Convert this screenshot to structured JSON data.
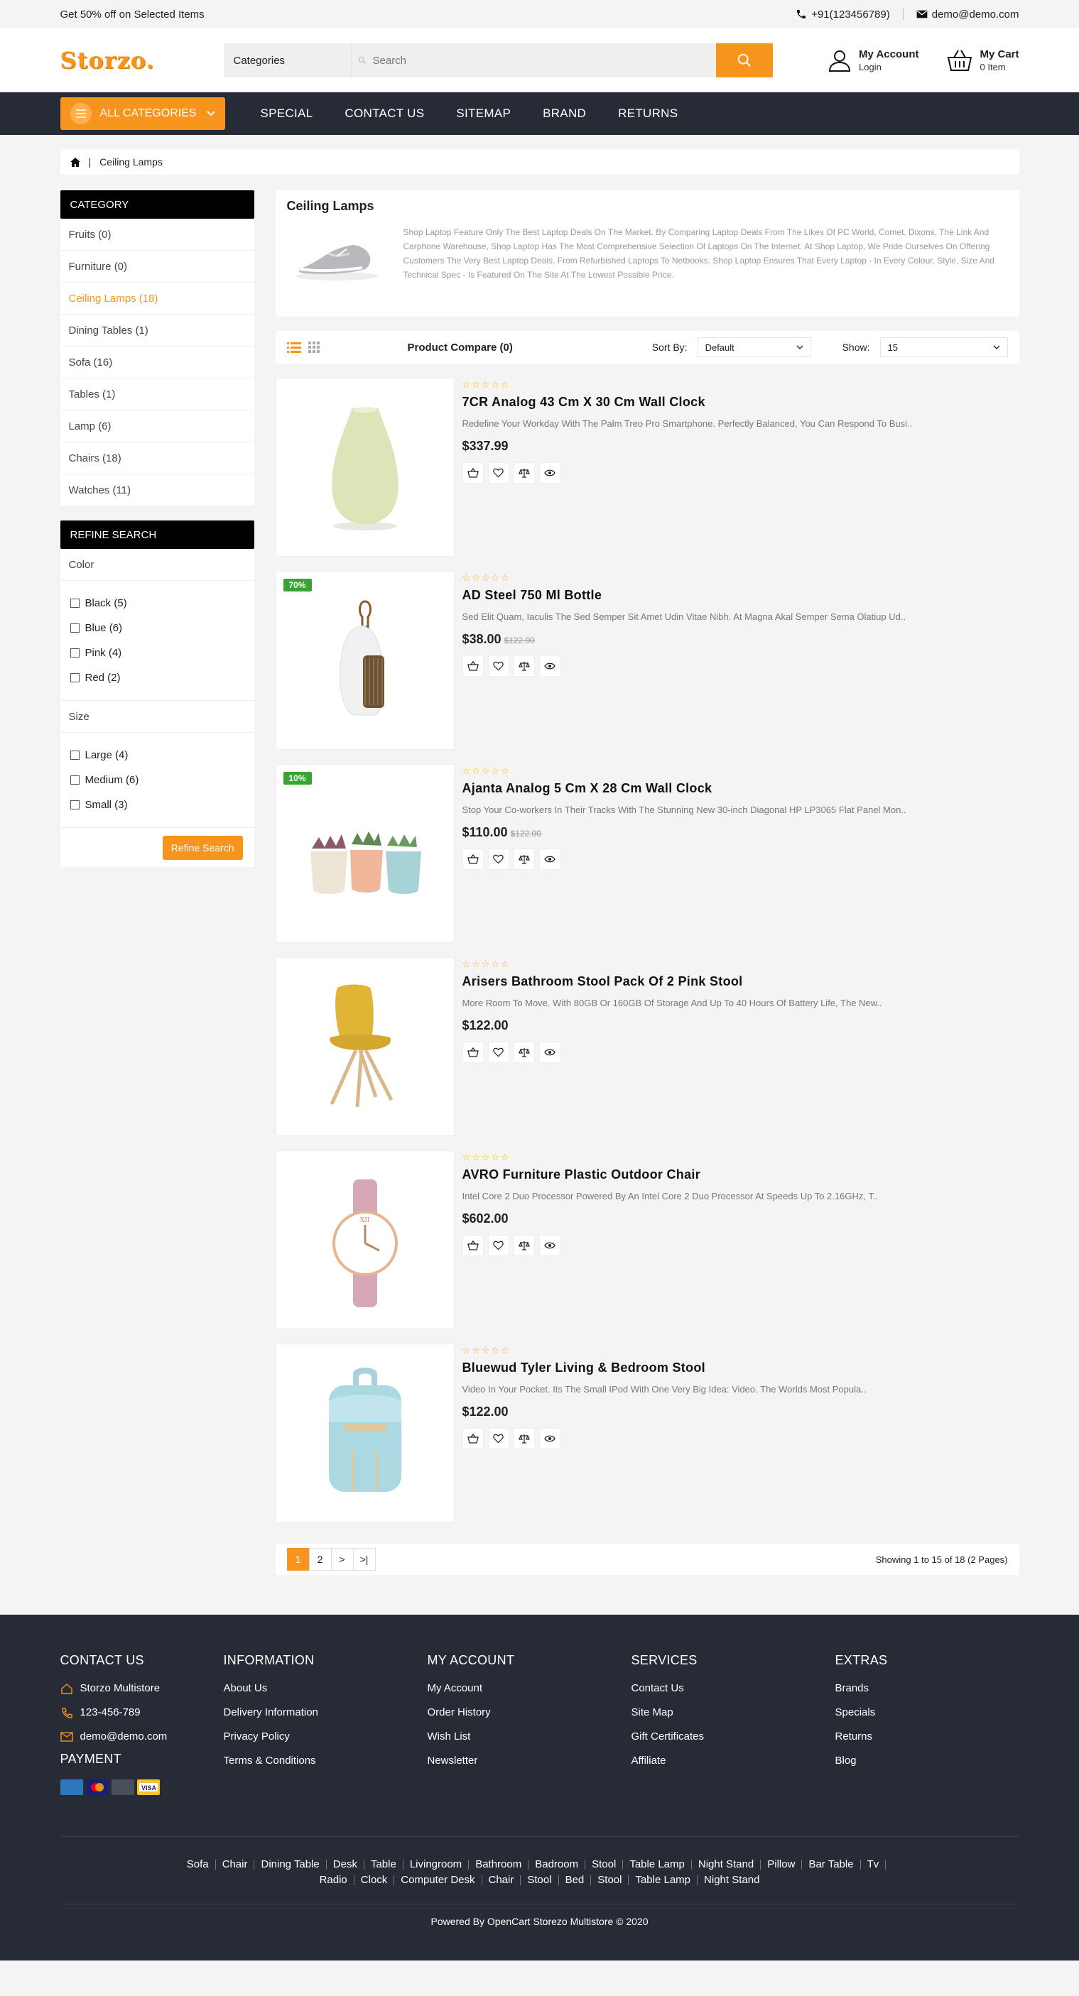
{
  "topbar": {
    "offer": "Get 50% off on Selected Items",
    "phone": "+91(123456789)",
    "email": "demo@demo.com"
  },
  "header": {
    "logo": "Storzo.",
    "search_category": "Categories",
    "search_placeholder": "Search",
    "account_title": "My Account",
    "account_sub": "Login",
    "cart_title": "My Cart",
    "cart_sub": "0 Item"
  },
  "nav": {
    "all_categories": "ALL CATEGORIES",
    "links": [
      "SPECIAL",
      "CONTACT US",
      "SITEMAP",
      "BRAND",
      "RETURNS"
    ]
  },
  "breadcrumb": {
    "sep": "|",
    "current": "Ceiling Lamps"
  },
  "sidebar": {
    "category_title": "CATEGORY",
    "categories": [
      "Fruits (0)",
      "Furniture (0)",
      "Ceiling Lamps (18)",
      "Dining Tables (1)",
      "Sofa (16)",
      "Tables (1)",
      "Lamp (6)",
      "Chairs (18)",
      "Watches (11)"
    ],
    "refine_title": "REFINE SEARCH",
    "color_label": "Color",
    "colors": [
      "Black (5)",
      "Blue (6)",
      "Pink (4)",
      "Red (2)"
    ],
    "size_label": "Size",
    "sizes": [
      "Large (4)",
      "Medium (6)",
      "Small (3)"
    ],
    "refine_button": "Refine Search"
  },
  "category": {
    "title": "Ceiling Lamps",
    "description": "Shop Laptop Feature Only The Best Laptop Deals On The Market. By Comparing Laptop Deals From The Likes Of PC World, Comet, Dixons, The Link And Carphone Warehouse, Shop Laptop Has The Most Comprehensive Selection Of Laptops On The Internet. At Shop Laptop, We Pride Ourselves On Offering Customers The Very Best Laptop Deals. From Refurbished Laptops To Netbooks, Shop Laptop Ensures That Every Laptop - In Every Colour, Style, Size And Technical Spec - Is Featured On The Site At The Lowest Possible Price."
  },
  "toolbar": {
    "compare": "Product Compare (0)",
    "sort_label": "Sort By:",
    "sort_value": "Default",
    "show_label": "Show:",
    "show_value": "15"
  },
  "products": [
    {
      "name": "7CR Analog 43 Cm X 30 Cm Wall Clock",
      "desc": "Redefine Your Workday With The Palm Treo Pro Smartphone. Perfectly Balanced, You Can Respond To Busi..",
      "price": "$337.99",
      "old_price": "",
      "badge": "",
      "stars": "☆☆☆☆☆"
    },
    {
      "name": "AD Steel 750 Ml Bottle",
      "desc": "Sed Elit Quam, Iaculis The Sed Semper Sit Amet Udin Vitae Nibh. At Magna Akal Semper Sema Olatiup Ud..",
      "price": "$38.00",
      "old_price": "$122.00",
      "badge": "70%",
      "stars": "☆☆☆☆☆"
    },
    {
      "name": "Ajanta Analog 5 Cm X 28 Cm Wall Clock",
      "desc": "Stop Your Co-workers In Their Tracks With The Stunning New 30-inch Diagonal HP LP3065 Flat Panel Mon..",
      "price": "$110.00",
      "old_price": "$122.00",
      "badge": "10%",
      "stars": "☆☆☆☆☆"
    },
    {
      "name": "Arisers Bathroom Stool Pack Of 2 Pink Stool",
      "desc": "More Room To Move. With 80GB Or 160GB Of Storage And Up To 40 Hours Of Battery Life, The New..",
      "price": "$122.00",
      "old_price": "",
      "badge": "",
      "stars": "☆☆☆☆☆"
    },
    {
      "name": "AVRO Furniture Plastic Outdoor Chair",
      "desc": "Intel Core 2 Duo Processor Powered By An Intel Core 2 Duo Processor At Speeds Up To 2.16GHz, T..",
      "price": "$602.00",
      "old_price": "",
      "badge": "",
      "stars": "☆☆☆☆☆"
    },
    {
      "name": "Bluewud Tyler Living & Bedroom Stool",
      "desc": "Video In Your Pocket. Its The Small IPod With One Very Big Idea: Video. The Worlds Most Popula..",
      "price": "$122.00",
      "old_price": "",
      "badge": "",
      "stars": "☆☆☆☆☆"
    }
  ],
  "pagination": {
    "pages": [
      "1",
      "2",
      ">",
      ">|"
    ],
    "info": "Showing 1 to 15 of 18 (2 Pages)"
  },
  "footer": {
    "contact_title": "CONTACT US",
    "contact": [
      "Storzo Multistore",
      "123-456-789",
      "demo@demo.com"
    ],
    "payment_title": "PAYMENT",
    "info_title": "INFORMATION",
    "info": [
      "About Us",
      "Delivery Information",
      "Privacy Policy",
      "Terms & Conditions"
    ],
    "account_title": "MY ACCOUNT",
    "account": [
      "My Account",
      "Order History",
      "Wish List",
      "Newsletter"
    ],
    "services_title": "SERVICES",
    "services": [
      "Contact Us",
      "Site Map",
      "Gift Certificates",
      "Affiliate"
    ],
    "extras_title": "EXTRAS",
    "extras": [
      "Brands",
      "Specials",
      "Returns",
      "Blog"
    ],
    "tags_row1": [
      "Sofa",
      "Chair",
      "Dining Table",
      "Desk",
      "Table",
      "Livingroom",
      "Bathroom",
      "Badroom",
      "Stool",
      "Table Lamp",
      "Night Stand",
      "Pillow",
      "Bar Table",
      "Tv",
      ""
    ],
    "tags_row2": [
      "Radio",
      "Clock",
      "Computer Desk",
      "Chair",
      "Stool",
      "Bed",
      "Stool",
      "Table Lamp",
      "Night Stand"
    ],
    "copyright": "Powered By OpenCart Storezo Multistore © 2020"
  },
  "colors": {
    "accent": "#f7941d",
    "dark": "#262b35",
    "badge": "#3aa336"
  }
}
